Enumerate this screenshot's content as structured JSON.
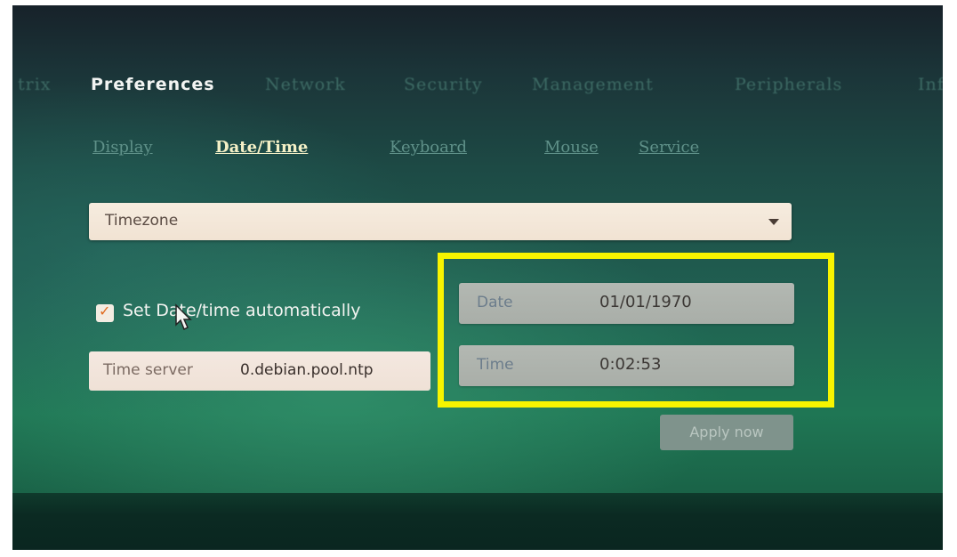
{
  "nav": {
    "tabs": [
      {
        "label": "trix",
        "active": false
      },
      {
        "label": "Preferences",
        "active": true
      },
      {
        "label": "Network",
        "active": false
      },
      {
        "label": "Security",
        "active": false
      },
      {
        "label": "Management",
        "active": false
      },
      {
        "label": "Peripherals",
        "active": false
      },
      {
        "label": "Inf",
        "active": false
      }
    ]
  },
  "subnav": {
    "tabs": [
      {
        "label": "Display",
        "active": false
      },
      {
        "label": "Date/Time",
        "active": true
      },
      {
        "label": "Keyboard",
        "active": false
      },
      {
        "label": "Mouse",
        "active": false
      },
      {
        "label": "Service",
        "active": false
      }
    ]
  },
  "timezone": {
    "value": "Timezone",
    "caret_icon": "chevron-down-icon"
  },
  "auto_datetime": {
    "checked": true,
    "label": "Set Date/time automatically"
  },
  "time_server": {
    "label": "Time server",
    "value": "0.debian.pool.ntp"
  },
  "date": {
    "label": "Date",
    "value": "01/01/1970"
  },
  "time": {
    "label": "Time",
    "value": "0:02:53"
  },
  "apply_button": {
    "label": "Apply now"
  },
  "colors": {
    "highlight": "#f8f400",
    "checkbox_tick": "#e06a1e",
    "active_subtab": "#f4f0c6"
  }
}
